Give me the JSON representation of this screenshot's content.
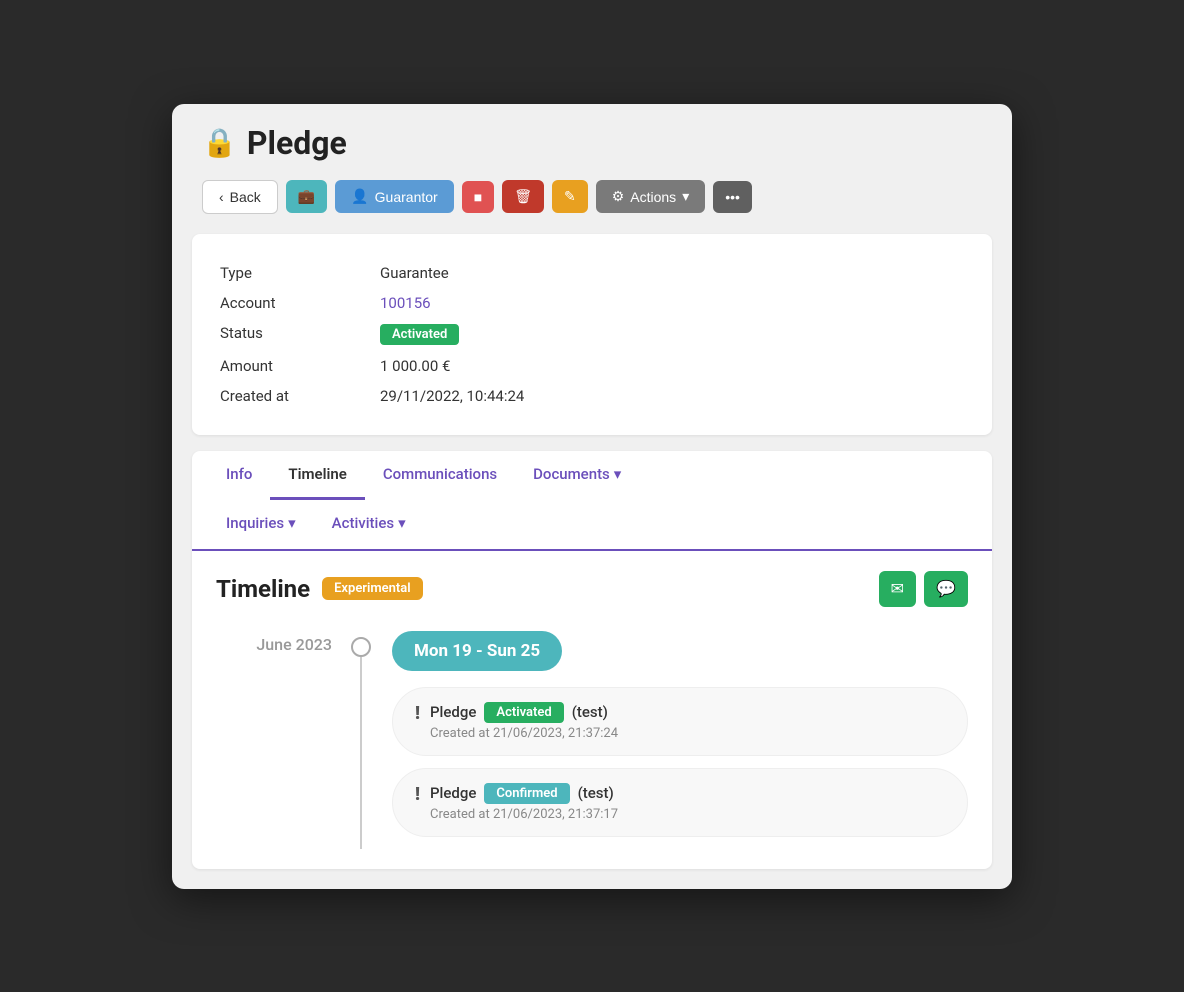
{
  "page": {
    "title": "Pledge",
    "lock_icon": "🔒"
  },
  "toolbar": {
    "back_label": "Back",
    "briefcase_icon": "💼",
    "guarantor_label": "Guarantor",
    "stop_icon": "■",
    "trash_icon": "🗑",
    "edit_icon": "✎",
    "actions_label": "Actions",
    "more_icon": "•••"
  },
  "info": {
    "type_label": "Type",
    "type_value": "Guarantee",
    "account_label": "Account",
    "account_value": "100156",
    "status_label": "Status",
    "status_value": "Activated",
    "amount_label": "Amount",
    "amount_value": "1 000.00 €",
    "created_at_label": "Created at",
    "created_at_value": "29/11/2022, 10:44:24"
  },
  "tabs": {
    "row1": [
      {
        "label": "Info",
        "active": false
      },
      {
        "label": "Timeline",
        "active": true
      },
      {
        "label": "Communications",
        "active": false
      },
      {
        "label": "Documents",
        "active": false,
        "has_dropdown": true
      }
    ],
    "row2": [
      {
        "label": "Inquiries",
        "has_dropdown": true
      },
      {
        "label": "Activities",
        "has_dropdown": true
      }
    ]
  },
  "timeline": {
    "title": "Timeline",
    "experimental_label": "Experimental",
    "email_icon": "✉",
    "sms_icon": "💬",
    "month_label": "June 2023",
    "week_label": "Mon 19 - Sun 25",
    "events": [
      {
        "type_label": "Pledge",
        "status": "Activated",
        "status_color": "activated",
        "note": "(test)",
        "created_at": "Created at 21/06/2023, 21:37:24"
      },
      {
        "type_label": "Pledge",
        "status": "Confirmed",
        "status_color": "confirmed",
        "note": "(test)",
        "created_at": "Created at 21/06/2023, 21:37:17"
      }
    ]
  }
}
